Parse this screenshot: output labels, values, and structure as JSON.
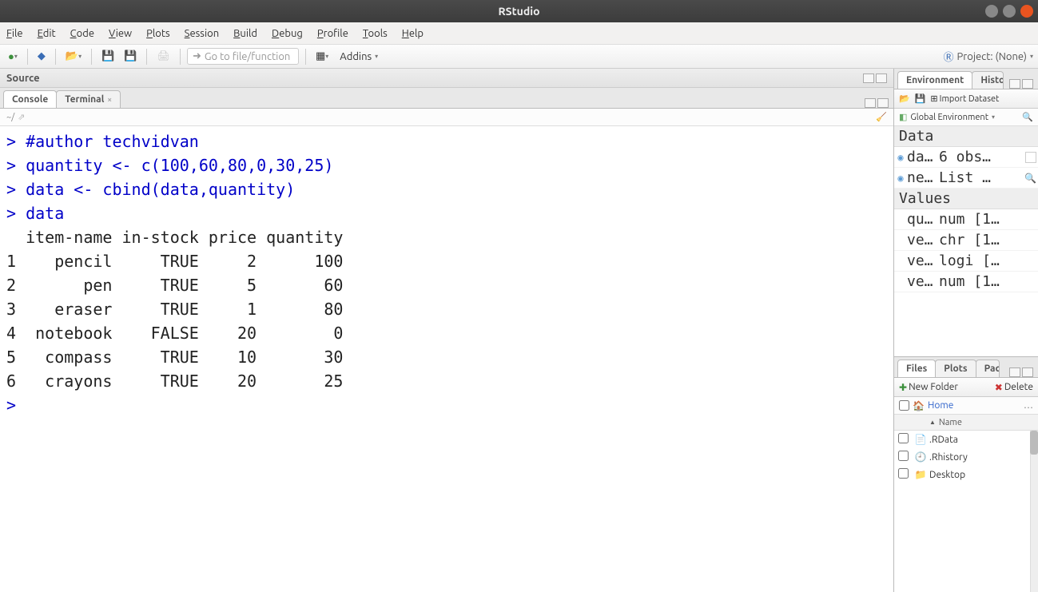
{
  "window": {
    "title": "RStudio"
  },
  "menu": [
    "File",
    "Edit",
    "Code",
    "View",
    "Plots",
    "Session",
    "Build",
    "Debug",
    "Profile",
    "Tools",
    "Help"
  ],
  "toolbar": {
    "go_to_placeholder": "Go to file/function",
    "addins_label": "Addins",
    "project_label": "Project: (None)"
  },
  "source_pane": {
    "title": "Source"
  },
  "console_pane": {
    "tabs": [
      "Console",
      "Terminal"
    ],
    "prompt_path": "~/",
    "lines": [
      {
        "type": "input",
        "text": "#author techvidvan"
      },
      {
        "type": "input",
        "text": "quantity <- c(100,60,80,0,30,25)"
      },
      {
        "type": "input",
        "text": "data <- cbind(data,quantity)"
      },
      {
        "type": "input",
        "text": "data"
      },
      {
        "type": "output",
        "text": "  item-name in-stock price quantity"
      },
      {
        "type": "output",
        "text": "1    pencil     TRUE     2      100"
      },
      {
        "type": "output",
        "text": "2       pen     TRUE     5       60"
      },
      {
        "type": "output",
        "text": "3    eraser     TRUE     1       80"
      },
      {
        "type": "output",
        "text": "4  notebook    FALSE    20        0"
      },
      {
        "type": "output",
        "text": "5   compass     TRUE    10       30"
      },
      {
        "type": "output",
        "text": "6   crayons     TRUE    20       25"
      },
      {
        "type": "input",
        "text": ""
      }
    ]
  },
  "env_pane": {
    "tabs": [
      "Environment",
      "History"
    ],
    "import_label": "Import Dataset",
    "scope_label": "Global Environment",
    "sections": {
      "data_header": "Data",
      "values_header": "Values"
    },
    "data_rows": [
      {
        "name": "da…",
        "value": "6 obs…",
        "badge": true
      },
      {
        "name": "ne…",
        "value": "List …",
        "badge": "search"
      }
    ],
    "value_rows": [
      {
        "name": "qu…",
        "value": "num [1…"
      },
      {
        "name": "ve…",
        "value": "chr [1…"
      },
      {
        "name": "ve…",
        "value": "logi […"
      },
      {
        "name": "ve…",
        "value": "num [1…"
      }
    ]
  },
  "files_pane": {
    "tabs": [
      "Files",
      "Plots",
      "Packages"
    ],
    "new_folder_label": "New Folder",
    "delete_label": "Delete",
    "home_label": "Home",
    "name_header": "Name",
    "items": [
      {
        "icon": "rdata",
        "name": ".RData"
      },
      {
        "icon": "rhist",
        "name": ".Rhistory"
      },
      {
        "icon": "folder",
        "name": "Desktop"
      }
    ]
  },
  "accent": {
    "input_blue": "#0000c8"
  }
}
